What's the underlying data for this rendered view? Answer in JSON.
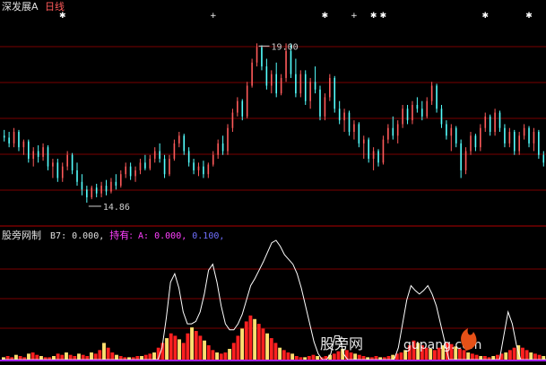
{
  "header": {
    "stock_name": "深发展A",
    "period": "日线"
  },
  "colors": {
    "up": "#ff5a5a",
    "down": "#54ffff",
    "grid": "#7a0000",
    "separator": "#b00000",
    "text": "#cfcfcf",
    "marker": "#ffffff",
    "vol_red": "#ff2020",
    "vol_yellow": "#ffe070",
    "purple": "#a020f0",
    "magenta": "#ff40ff",
    "blue": "#7070ff"
  },
  "price_panel": {
    "high_label": "19.00",
    "low_label": "14.86",
    "high_value": 19.0,
    "low_value": 14.86,
    "marker_glyph": "✱",
    "plus_glyph": "+",
    "updown_glyph": "↕"
  },
  "indicator": {
    "name": "股旁网制",
    "b7_label": "B7:",
    "b7_value": "0.000,",
    "hold_label": "持有:",
    "a_label": "A:",
    "a_value": "0.000,",
    "c_value": "0.100,"
  },
  "watermark": {
    "site_cn": "股旁网",
    "site_en": "gupang.com"
  },
  "chart_data": [
    {
      "type": "candlestick",
      "ylim": [
        14.3,
        19.8
      ],
      "candles": [
        [
          16.6,
          16.75,
          16.45,
          16.55
        ],
        [
          16.55,
          16.7,
          16.3,
          16.4
        ],
        [
          16.4,
          16.8,
          16.3,
          16.7
        ],
        [
          16.7,
          16.75,
          16.2,
          16.3
        ],
        [
          16.3,
          16.5,
          16.1,
          16.45
        ],
        [
          16.45,
          16.5,
          15.9,
          16.0
        ],
        [
          16.0,
          16.3,
          15.8,
          16.2
        ],
        [
          16.2,
          16.35,
          15.9,
          16.05
        ],
        [
          16.05,
          16.4,
          15.95,
          16.3
        ],
        [
          16.3,
          16.35,
          15.7,
          15.8
        ],
        [
          15.8,
          16.0,
          15.5,
          15.9
        ],
        [
          15.9,
          16.0,
          15.4,
          15.5
        ],
        [
          15.5,
          15.9,
          15.4,
          15.8
        ],
        [
          15.8,
          16.2,
          15.7,
          16.1
        ],
        [
          16.1,
          16.15,
          15.6,
          15.7
        ],
        [
          15.7,
          15.9,
          15.3,
          15.4
        ],
        [
          15.4,
          15.6,
          15.05,
          15.2
        ],
        [
          15.2,
          15.3,
          14.86,
          15.0
        ],
        [
          15.0,
          15.3,
          14.95,
          15.25
        ],
        [
          15.25,
          15.35,
          15.0,
          15.1
        ],
        [
          15.1,
          15.4,
          15.0,
          15.3
        ],
        [
          15.3,
          15.45,
          15.05,
          15.15
        ],
        [
          15.15,
          15.5,
          15.1,
          15.4
        ],
        [
          15.4,
          15.6,
          15.2,
          15.3
        ],
        [
          15.3,
          15.7,
          15.25,
          15.6
        ],
        [
          15.6,
          15.9,
          15.5,
          15.8
        ],
        [
          15.8,
          15.9,
          15.45,
          15.55
        ],
        [
          15.55,
          15.8,
          15.4,
          15.7
        ],
        [
          15.7,
          16.0,
          15.6,
          15.9
        ],
        [
          15.9,
          16.1,
          15.7,
          15.75
        ],
        [
          15.75,
          16.1,
          15.7,
          16.0
        ],
        [
          16.0,
          16.3,
          15.9,
          16.2
        ],
        [
          16.2,
          16.4,
          15.9,
          16.0
        ],
        [
          16.0,
          16.1,
          15.5,
          15.6
        ],
        [
          15.6,
          16.1,
          15.55,
          16.0
        ],
        [
          16.0,
          16.5,
          15.95,
          16.4
        ],
        [
          16.4,
          16.7,
          16.3,
          16.6
        ],
        [
          16.6,
          16.65,
          16.1,
          16.2
        ],
        [
          16.2,
          16.3,
          15.8,
          15.9
        ],
        [
          15.9,
          16.0,
          15.6,
          15.7
        ],
        [
          15.7,
          15.9,
          15.55,
          15.8
        ],
        [
          15.8,
          15.95,
          15.5,
          15.6
        ],
        [
          15.6,
          15.9,
          15.5,
          15.85
        ],
        [
          15.85,
          16.2,
          15.8,
          16.1
        ],
        [
          16.1,
          16.5,
          16.0,
          16.4
        ],
        [
          16.4,
          16.6,
          16.1,
          16.2
        ],
        [
          16.2,
          16.9,
          16.1,
          16.8
        ],
        [
          16.8,
          17.3,
          16.7,
          17.2
        ],
        [
          17.2,
          17.6,
          17.1,
          17.5
        ],
        [
          17.5,
          17.55,
          17.0,
          17.1
        ],
        [
          17.1,
          18.0,
          17.05,
          17.9
        ],
        [
          17.9,
          18.6,
          17.85,
          18.5
        ],
        [
          18.5,
          19.0,
          18.4,
          18.9
        ],
        [
          18.9,
          18.95,
          18.3,
          18.4
        ],
        [
          18.4,
          18.6,
          17.8,
          17.9
        ],
        [
          17.9,
          18.3,
          17.7,
          18.2
        ],
        [
          18.2,
          18.5,
          17.6,
          17.7
        ],
        [
          17.7,
          18.2,
          17.65,
          18.1
        ],
        [
          18.1,
          19.0,
          18.0,
          18.8
        ],
        [
          18.8,
          19.0,
          18.1,
          18.2
        ],
        [
          18.2,
          18.6,
          17.6,
          17.7
        ],
        [
          17.7,
          18.3,
          17.6,
          18.2
        ],
        [
          18.2,
          18.3,
          17.4,
          17.5
        ],
        [
          17.5,
          18.1,
          17.3,
          18.0
        ],
        [
          18.0,
          18.4,
          17.7,
          17.8
        ],
        [
          17.8,
          17.9,
          17.0,
          17.1
        ],
        [
          17.1,
          17.7,
          17.0,
          17.6
        ],
        [
          17.6,
          18.2,
          17.5,
          18.1
        ],
        [
          18.1,
          18.15,
          17.2,
          17.3
        ],
        [
          17.3,
          17.5,
          16.9,
          17.0
        ],
        [
          17.0,
          17.3,
          16.7,
          17.2
        ],
        [
          17.2,
          17.25,
          16.6,
          16.7
        ],
        [
          16.7,
          17.0,
          16.5,
          16.9
        ],
        [
          16.9,
          16.95,
          16.3,
          16.4
        ],
        [
          16.4,
          16.6,
          16.0,
          16.5
        ],
        [
          16.5,
          16.55,
          15.9,
          16.0
        ],
        [
          16.0,
          16.3,
          15.7,
          16.2
        ],
        [
          16.2,
          16.25,
          15.8,
          15.9
        ],
        [
          15.9,
          16.6,
          15.85,
          16.5
        ],
        [
          16.5,
          16.9,
          16.4,
          16.8
        ],
        [
          16.8,
          17.1,
          16.5,
          16.6
        ],
        [
          16.6,
          17.0,
          16.4,
          16.9
        ],
        [
          16.9,
          17.4,
          16.8,
          17.3
        ],
        [
          17.3,
          17.4,
          16.9,
          17.0
        ],
        [
          17.0,
          17.5,
          16.9,
          17.4
        ],
        [
          17.4,
          17.6,
          17.2,
          17.3
        ],
        [
          17.3,
          17.5,
          17.0,
          17.1
        ],
        [
          17.1,
          17.6,
          17.05,
          17.5
        ],
        [
          17.5,
          18.0,
          17.4,
          17.9
        ],
        [
          17.9,
          17.95,
          17.2,
          17.3
        ],
        [
          17.3,
          17.4,
          16.8,
          16.9
        ],
        [
          16.9,
          17.0,
          16.5,
          16.6
        ],
        [
          16.6,
          16.9,
          16.2,
          16.8
        ],
        [
          16.8,
          16.85,
          16.3,
          16.4
        ],
        [
          16.4,
          16.5,
          15.5,
          15.7
        ],
        [
          15.7,
          16.3,
          15.6,
          16.2
        ],
        [
          16.2,
          16.7,
          16.1,
          16.6
        ],
        [
          16.6,
          16.65,
          16.2,
          16.3
        ],
        [
          16.3,
          16.9,
          16.2,
          16.8
        ],
        [
          16.8,
          17.2,
          16.7,
          17.1
        ],
        [
          17.1,
          17.15,
          16.6,
          16.7
        ],
        [
          16.7,
          17.3,
          16.6,
          17.2
        ],
        [
          17.2,
          17.25,
          16.7,
          16.8
        ],
        [
          16.8,
          16.9,
          16.3,
          16.4
        ],
        [
          16.4,
          16.8,
          16.3,
          16.7
        ],
        [
          16.7,
          16.75,
          16.1,
          16.2
        ],
        [
          16.2,
          16.7,
          16.1,
          16.6
        ],
        [
          16.6,
          16.9,
          16.5,
          16.8
        ],
        [
          16.8,
          16.85,
          16.3,
          16.4
        ],
        [
          16.4,
          16.8,
          16.2,
          16.7
        ],
        [
          16.7,
          16.75,
          16.0,
          16.1
        ],
        [
          16.1,
          16.2,
          15.8,
          15.9
        ]
      ]
    },
    {
      "type": "line",
      "name": "B7",
      "ylim": [
        0,
        1
      ],
      "values": [
        0,
        0,
        0,
        0,
        0,
        0,
        0,
        0,
        0,
        0,
        0,
        0,
        0,
        0,
        0,
        0,
        0,
        0,
        0,
        0,
        0,
        0,
        0,
        0,
        0,
        0,
        0,
        0,
        0,
        0,
        0,
        0,
        0,
        0,
        0,
        0,
        0,
        0,
        0.1,
        0.35,
        0.65,
        0.72,
        0.6,
        0.4,
        0.3,
        0.3,
        0.32,
        0.4,
        0.55,
        0.75,
        0.8,
        0.65,
        0.45,
        0.3,
        0.25,
        0.25,
        0.3,
        0.38,
        0.5,
        0.62,
        0.68,
        0.75,
        0.82,
        0.9,
        0.98,
        1.0,
        0.95,
        0.88,
        0.84,
        0.8,
        0.72,
        0.6,
        0.45,
        0.3,
        0.15,
        0.05,
        0,
        0,
        0.05,
        0.2,
        0.2,
        0.05,
        0,
        0,
        0,
        0,
        0,
        0,
        0,
        0,
        0,
        0,
        0,
        0,
        0.1,
        0.3,
        0.5,
        0.62,
        0.58,
        0.55,
        0.58,
        0.62,
        0.55,
        0.45,
        0.3,
        0.15,
        0,
        0,
        0,
        0,
        0,
        0,
        0,
        0,
        0,
        0,
        0,
        0,
        0,
        0.2,
        0.4,
        0.3,
        0.12,
        0,
        0,
        0,
        0,
        0,
        0,
        0
      ]
    },
    {
      "type": "bar",
      "name": "volume",
      "ylim": [
        0,
        1
      ],
      "values": [
        0.02,
        0.03,
        0.02,
        0.04,
        0.03,
        0.02,
        0.05,
        0.06,
        0.04,
        0.03,
        0.02,
        0.02,
        0.03,
        0.05,
        0.04,
        0.06,
        0.04,
        0.03,
        0.05,
        0.04,
        0.03,
        0.06,
        0.05,
        0.08,
        0.14,
        0.1,
        0.06,
        0.04,
        0.03,
        0.02,
        0.02,
        0.02,
        0.03,
        0.03,
        0.04,
        0.05,
        0.06,
        0.1,
        0.14,
        0.18,
        0.22,
        0.2,
        0.17,
        0.14,
        0.22,
        0.27,
        0.24,
        0.2,
        0.16,
        0.12,
        0.08,
        0.06,
        0.05,
        0.06,
        0.09,
        0.14,
        0.2,
        0.26,
        0.32,
        0.37,
        0.34,
        0.3,
        0.26,
        0.22,
        0.18,
        0.14,
        0.1,
        0.08,
        0.06,
        0.05,
        0.03,
        0.02,
        0.02,
        0.03,
        0.04,
        0.03,
        0.02,
        0.03,
        0.04,
        0.05,
        0.07,
        0.09,
        0.08,
        0.06,
        0.05,
        0.04,
        0.03,
        0.02,
        0.02,
        0.03,
        0.02,
        0.02,
        0.03,
        0.04,
        0.05,
        0.06,
        0.08,
        0.12,
        0.16,
        0.14,
        0.12,
        0.1,
        0.09,
        0.08,
        0.1,
        0.12,
        0.14,
        0.13,
        0.11,
        0.09,
        0.08,
        0.06,
        0.05,
        0.04,
        0.03,
        0.03,
        0.02,
        0.03,
        0.04,
        0.05,
        0.06,
        0.08,
        0.1,
        0.12,
        0.1,
        0.08,
        0.06,
        0.05,
        0.04,
        0.03
      ]
    }
  ]
}
